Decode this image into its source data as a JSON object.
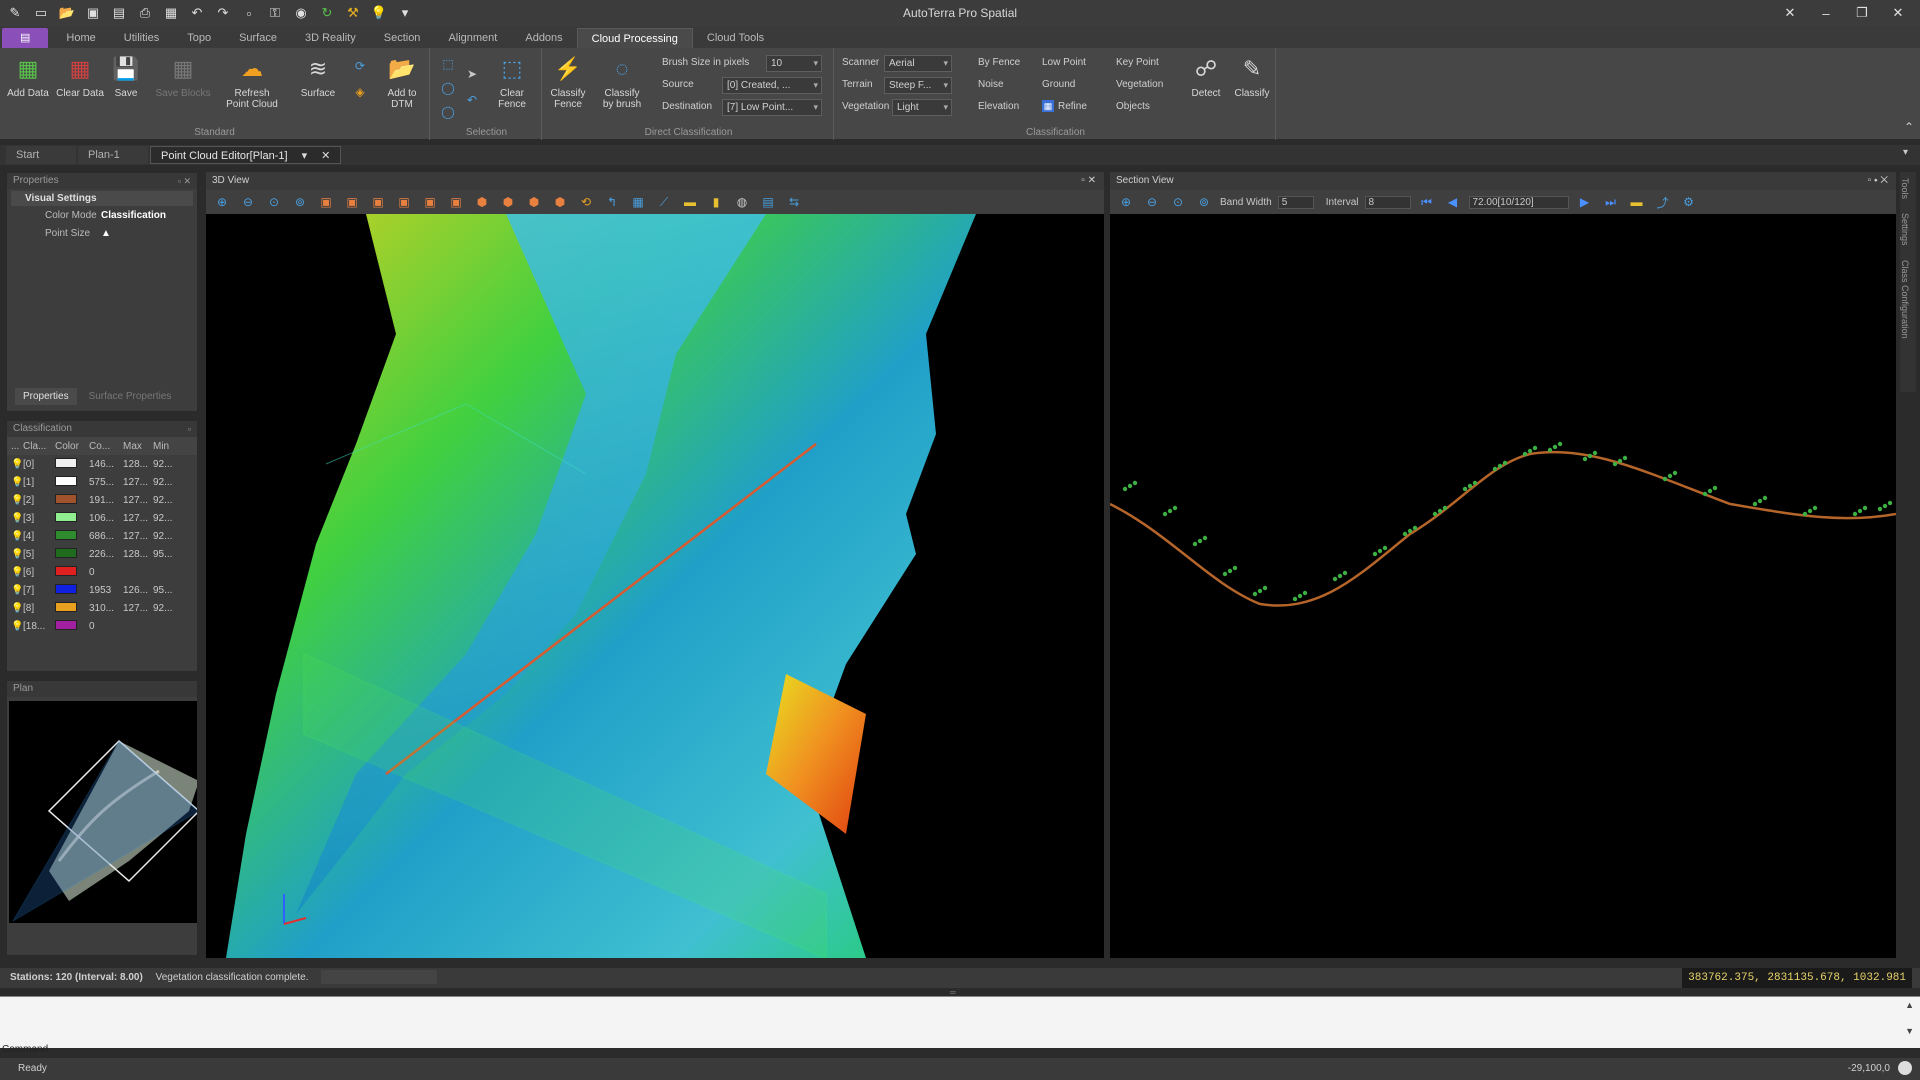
{
  "app": {
    "title": "AutoTerra Pro Spatial"
  },
  "ribbon_tabs": [
    "Home",
    "Utilities",
    "Topo",
    "Surface",
    "3D Reality",
    "Section",
    "Alignment",
    "Addons",
    "Cloud Processing",
    "Cloud Tools"
  ],
  "ribbon": {
    "standard": {
      "label": "Standard",
      "buttons": [
        "Add Data",
        "Clear Data",
        "Save",
        "Save Blocks",
        "Refresh Point Cloud",
        "Surface",
        "Add to DTM"
      ]
    },
    "selection": {
      "label": "Selection",
      "clear_fence": "Clear Fence"
    },
    "direct": {
      "label": "Direct Classification",
      "classify_fence": "Classify Fence",
      "classify_brush": "Classify by brush",
      "brush_size_label": "Brush Size in pixels",
      "brush_size_value": "10",
      "source_label": "Source",
      "source_value": "[0] Created, ...",
      "destination_label": "Destination",
      "destination_value": "[7] Low Point..."
    },
    "classification": {
      "label": "Classification",
      "scanner_label": "Scanner",
      "scanner_value": "Aerial",
      "terrain_label": "Terrain",
      "terrain_value": "Steep F...",
      "vegetation_label": "Vegetation",
      "vegetation_value": "Light",
      "by_fence": "By Fence",
      "noise": "Noise",
      "elevation": "Elevation",
      "low_point": "Low Point",
      "ground": "Ground",
      "refine": "Refine",
      "key_point": "Key Point",
      "vegetation": "Vegetation",
      "objects": "Objects",
      "detect": "Detect",
      "classify": "Classify"
    }
  },
  "doc_tabs": [
    "Start",
    "Plan-1",
    "Point Cloud Editor[Plan-1]"
  ],
  "properties": {
    "title": "Properties",
    "section": "Visual Settings",
    "rows": [
      {
        "k": "Color Mode",
        "v": "Classification"
      },
      {
        "k": "Point Size",
        "v": ""
      }
    ],
    "tabs": [
      "Properties",
      "Surface Properties"
    ]
  },
  "classification": {
    "title": "Classification",
    "headers": [
      "...",
      "Cla...",
      "Color",
      "Co...",
      "Max",
      "Min"
    ],
    "rows": [
      {
        "cls": "[0]",
        "color": "#f0f0f0",
        "count": "146...",
        "max": "128...",
        "min": "92..."
      },
      {
        "cls": "[1]",
        "color": "#ffffff",
        "count": "575...",
        "max": "127...",
        "min": "92..."
      },
      {
        "cls": "[2]",
        "color": "#a0522d",
        "count": "191...",
        "max": "127...",
        "min": "92..."
      },
      {
        "cls": "[3]",
        "color": "#90ee90",
        "count": "106...",
        "max": "127...",
        "min": "92..."
      },
      {
        "cls": "[4]",
        "color": "#2e8b2e",
        "count": "686...",
        "max": "127...",
        "min": "92..."
      },
      {
        "cls": "[5]",
        "color": "#1e6b1e",
        "count": "226...",
        "max": "128...",
        "min": "95..."
      },
      {
        "cls": "[6]",
        "color": "#e02020",
        "count": "0",
        "max": "",
        "min": ""
      },
      {
        "cls": "[7]",
        "color": "#1020e0",
        "count": "1953",
        "max": "126...",
        "min": "95..."
      },
      {
        "cls": "[8]",
        "color": "#e8a020",
        "count": "310...",
        "max": "127...",
        "min": "92..."
      },
      {
        "cls": "[18...",
        "color": "#a020a0",
        "count": "0",
        "max": "",
        "min": ""
      }
    ]
  },
  "plan": {
    "title": "Plan"
  },
  "view3d": {
    "title": "3D View"
  },
  "section": {
    "title": "Section View",
    "band_width_label": "Band Width",
    "band_width_value": "5",
    "interval_label": "Interval",
    "interval_value": "8",
    "station_value": "72.00[10/120]"
  },
  "right_rail": [
    "Tools",
    "Settings",
    "Class Configuration"
  ],
  "status": {
    "stations": "Stations: 120 (Interval: 8.00)",
    "message": "Vegetation classification complete.",
    "coords": "383762.375, 2831135.678, 1032.981",
    "command_label": "Command",
    "ready": "Ready",
    "zoom": "-29,100,0"
  },
  "colors": {
    "accent": "#8a4fb8",
    "ground": "#b5652a",
    "veg": "#3cb043"
  }
}
